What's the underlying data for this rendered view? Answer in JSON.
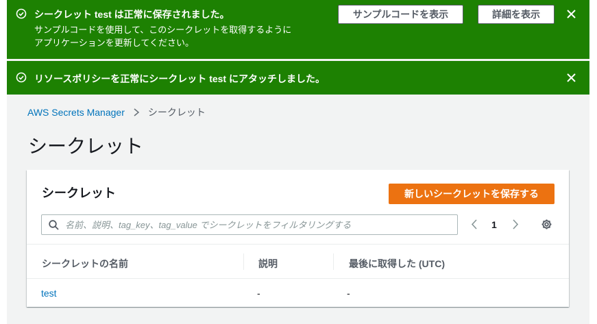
{
  "flash_success": {
    "title": "シークレット test は正常に保存されました。",
    "body_line1": "サンプルコードを使用して、このシークレットを取得するように",
    "body_line2": "アプリケーションを更新してください。",
    "view_sample_code_label": "サンプルコードを表示",
    "view_details_label": "詳細を表示"
  },
  "flash_policy": {
    "title": "リソースポリシーを正常にシークレット test にアタッチしました。"
  },
  "breadcrumb": {
    "root": "AWS Secrets Manager",
    "current": "シークレット"
  },
  "page": {
    "title": "シークレット"
  },
  "panel": {
    "title": "シークレット",
    "store_new_secret_label": "新しいシークレットを保存する",
    "search_placeholder": "名前、説明、tag_key、tag_value でシークレットをフィルタリングする",
    "search_value": "",
    "current_page": "1"
  },
  "table": {
    "columns": [
      "シークレットの名前",
      "説明",
      "最後に取得した (UTC)"
    ],
    "rows": [
      {
        "name": "test",
        "description": "-",
        "last_retrieved": "-"
      }
    ]
  },
  "colors": {
    "success": "#1d8102",
    "primary": "#ec7211",
    "link": "#0073bb",
    "background": "#f2f3f3"
  },
  "icons": [
    "check-circle-icon",
    "close-icon",
    "chevron-right-icon",
    "search-icon",
    "chevron-left-icon",
    "gear-icon"
  ]
}
